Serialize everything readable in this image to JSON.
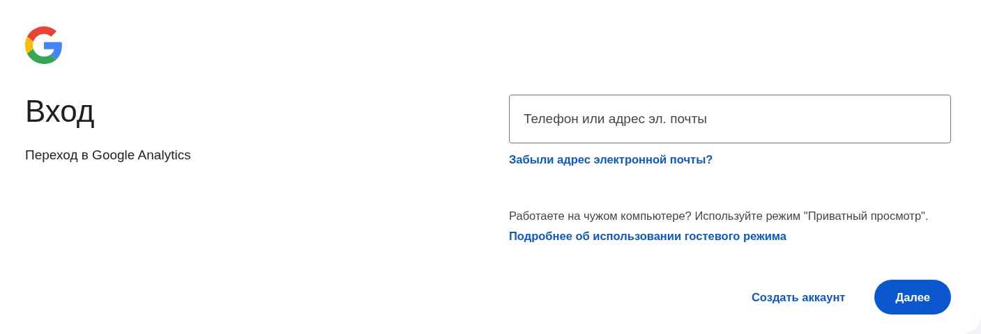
{
  "heading": "Вход",
  "subtitle": "Переход в Google Analytics",
  "email_field": {
    "placeholder": "Телефон или адрес эл. почты"
  },
  "forgot_link": "Забыли адрес электронной почты?",
  "guest_note": {
    "text": "Работаете на чужом компьютере? Используйте режим \"Приватный просмотр\". ",
    "link": "Подробнее об использовании гостевого режима"
  },
  "buttons": [
    {
      "label": "Создать аккаунт",
      "kind": "text"
    },
    {
      "label": "Далее",
      "kind": "filled"
    }
  ]
}
